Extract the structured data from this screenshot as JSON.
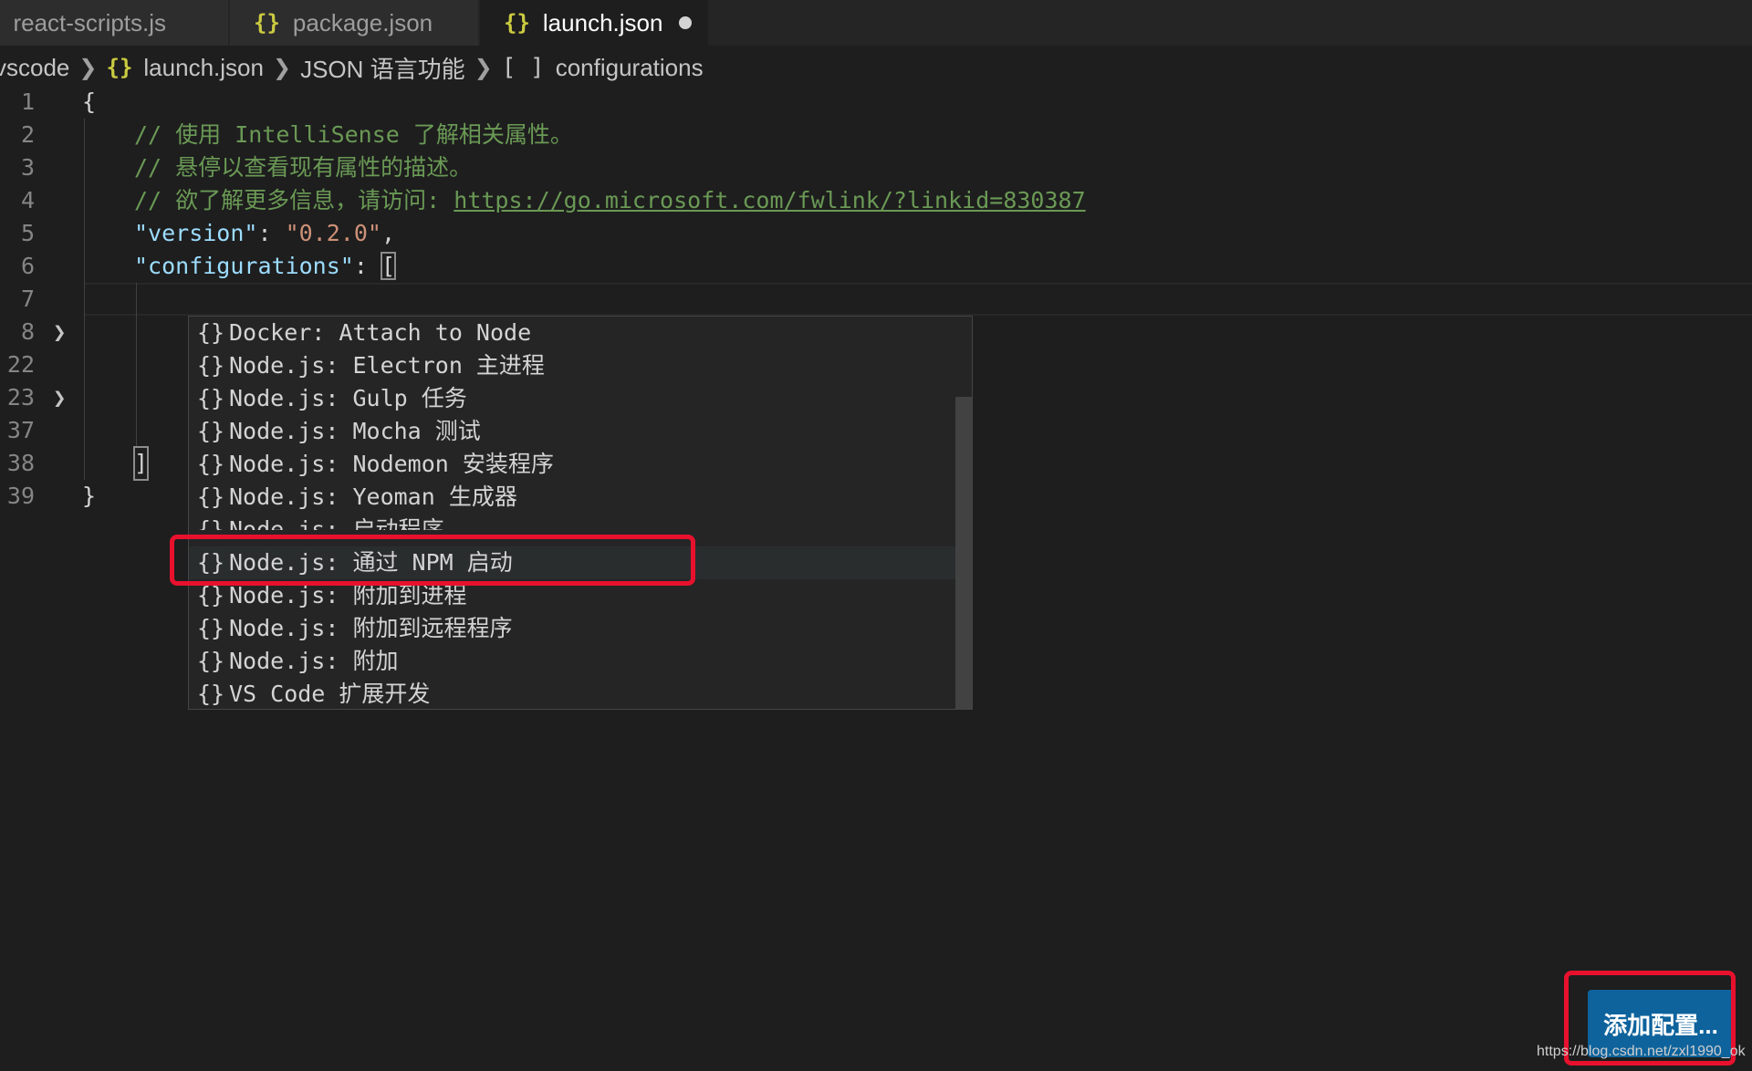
{
  "tabs": [
    {
      "icon": "JS",
      "label": "react-scripts.js"
    },
    {
      "icon": "{}",
      "label": "package.json"
    },
    {
      "icon": "{}",
      "label": "launch.json",
      "active": true,
      "modified": true
    }
  ],
  "breadcrumb": {
    "folder": "vscode",
    "file_icon": "{}",
    "file": "launch.json",
    "section": "JSON 语言功能",
    "array_icon": "[ ]",
    "symbol": "configurations"
  },
  "editor": {
    "lines": [
      {
        "num": "1",
        "folded": false
      },
      {
        "num": "2",
        "folded": false
      },
      {
        "num": "3",
        "folded": false
      },
      {
        "num": "4",
        "folded": false
      },
      {
        "num": "5",
        "folded": false
      },
      {
        "num": "6",
        "folded": false
      },
      {
        "num": "7",
        "folded": false
      },
      {
        "num": "8",
        "folded": true
      },
      {
        "num": "22",
        "folded": false
      },
      {
        "num": "23",
        "folded": true
      },
      {
        "num": "37",
        "folded": false
      },
      {
        "num": "38",
        "folded": false
      },
      {
        "num": "39",
        "folded": false
      }
    ],
    "open_brace": "{",
    "close_brace": "}",
    "comment1": "// 使用 IntelliSense 了解相关属性。",
    "comment2": "// 悬停以查看现有属性的描述。",
    "comment3_prefix": "// 欲了解更多信息，请访问: ",
    "comment3_link": "https://go.microsoft.com/fwlink/?linkid=830387",
    "version_key": "\"version\"",
    "version_value": "\"0.2.0\"",
    "config_key": "\"configurations\"",
    "array_open": "[",
    "array_close": "]",
    "colon": ": ",
    "comma": ","
  },
  "suggestions": {
    "icon": "{}",
    "items": [
      "Docker: Attach to Node",
      "Node.js: Electron 主进程",
      "Node.js: Gulp 任务",
      "Node.js: Mocha 测试",
      "Node.js: Nodemon 安装程序",
      "Node.js: Yeoman 生成器",
      "Node.js: 启动程序",
      "Node.js: 通过 NPM 启动",
      "Node.js: 附加到进程",
      "Node.js: 附加到远程程序",
      "Node.js: 附加",
      "VS Code 扩展开发"
    ],
    "focused_index": 7
  },
  "add_config_button": "添加配置...",
  "watermark": "https://blog.csdn.net/zxl1990_ok",
  "colors": {
    "highlight": "#e8112d",
    "button": "#0e639c",
    "comment": "#6a9955",
    "key": "#9cdcfe",
    "string": "#ce9178"
  }
}
